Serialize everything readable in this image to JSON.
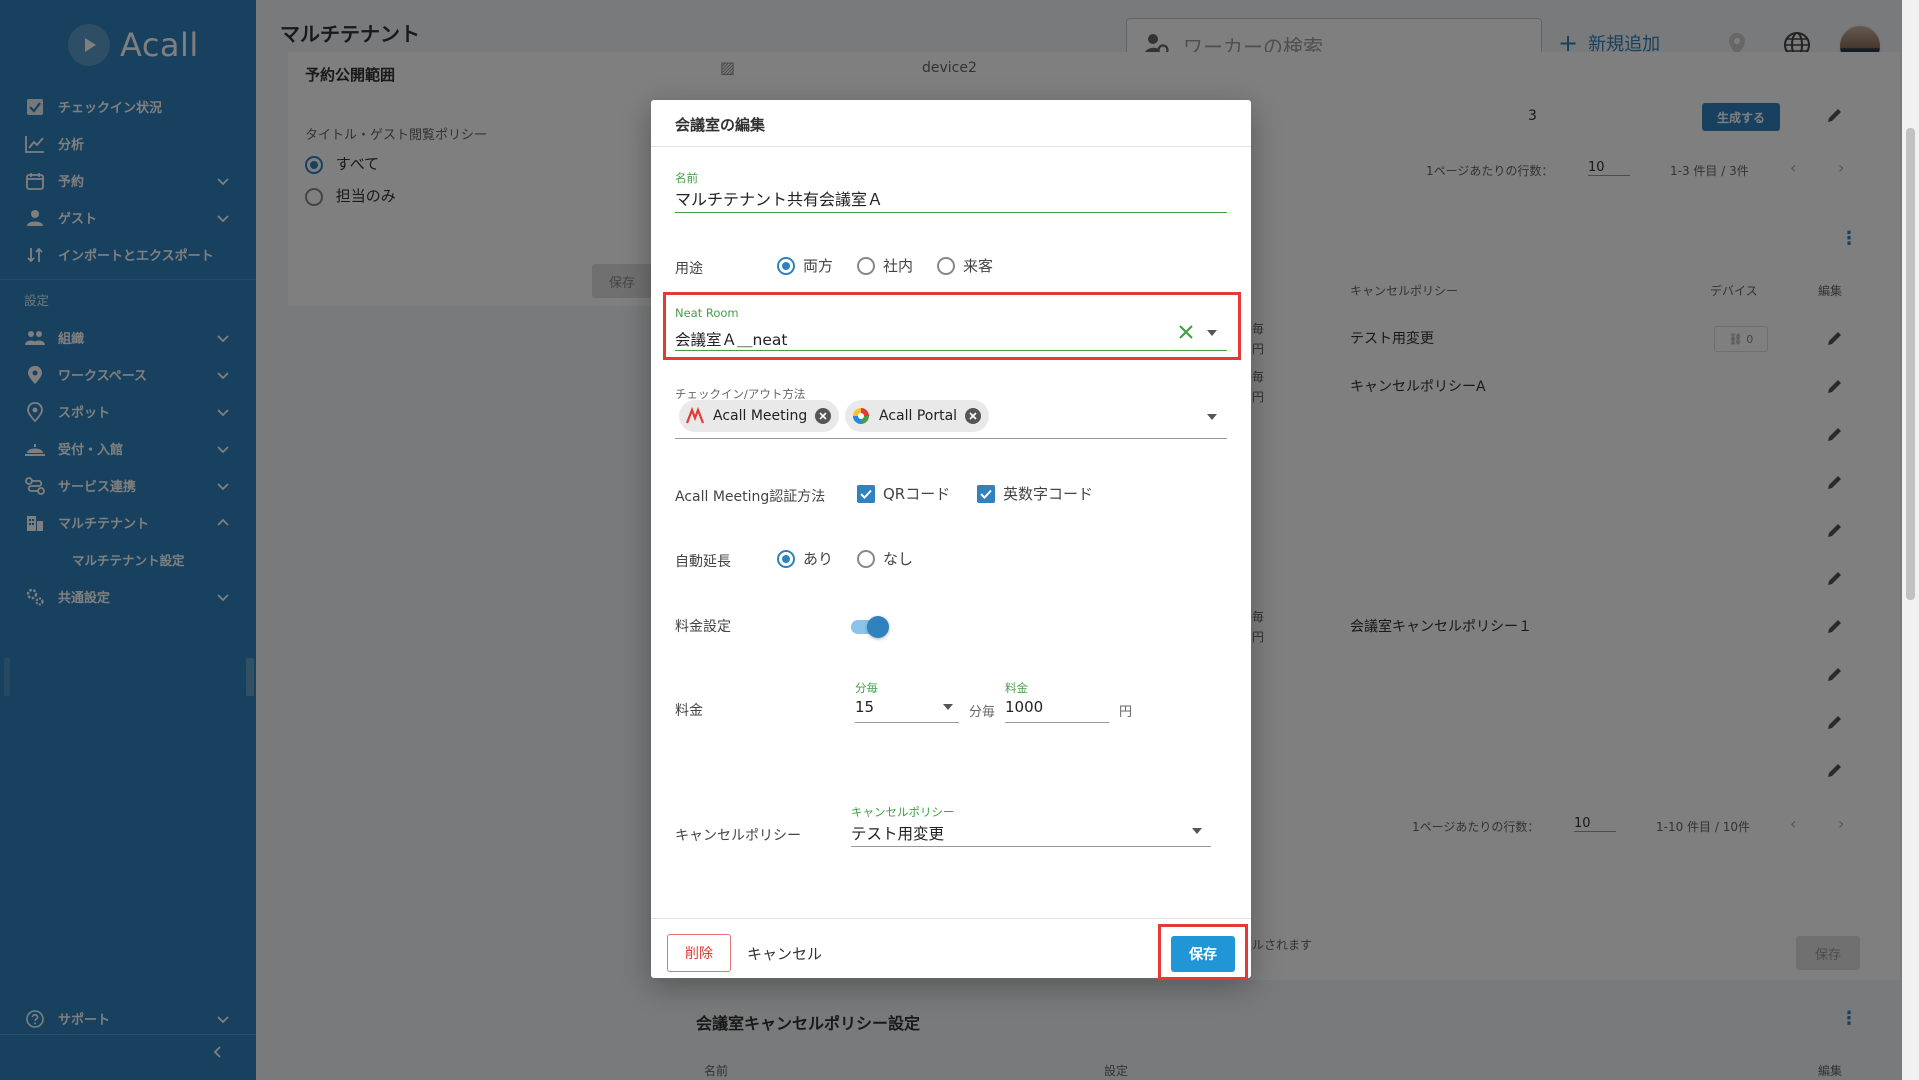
{
  "app": {
    "logo": "Acall",
    "page_title": "マルチテナント"
  },
  "sidebar": {
    "items": [
      {
        "label": "チェックイン状況",
        "icon": "check-box-icon"
      },
      {
        "label": "分析",
        "icon": "chart-icon"
      },
      {
        "label": "予約",
        "icon": "calendar-icon"
      },
      {
        "label": "ゲスト",
        "icon": "person-icon"
      },
      {
        "label": "インポートとエクスポート",
        "icon": "import-export-icon"
      }
    ],
    "section_label": "設定",
    "settings_items": [
      {
        "label": "組織",
        "icon": "group-icon"
      },
      {
        "label": "ワークスペース",
        "icon": "location-pin-icon"
      },
      {
        "label": "スポット",
        "icon": "spot-pin-icon"
      },
      {
        "label": "受付・入館",
        "icon": "reception-icon"
      },
      {
        "label": "サービス連携",
        "icon": "integration-icon"
      },
      {
        "label": "マルチテナント",
        "icon": "building-icon"
      }
    ],
    "sub_item": "マルチテナント設定",
    "common_settings": "共通設定",
    "support": "サポート"
  },
  "header": {
    "search_placeholder": "ワーカーの検索",
    "add_label": "新規追加"
  },
  "background": {
    "publish_scope_title": "予約公開範囲",
    "policy_label": "タイトル・ゲスト閲覧ポリシー",
    "policy_all": "すべて",
    "policy_owner": "担当のみ",
    "save": "保存",
    "device_col": "device2",
    "count": "3",
    "generate": "生成する",
    "rows_per_page": "1ページあたりの行数：",
    "rows_value": "10",
    "range1": "1-3 件目 / 3件",
    "range2": "1-10 件目 / 10件",
    "col_cancel_policy": "キャンセルポリシー",
    "col_device": "デバイス",
    "col_edit": "編集",
    "policy_rows": [
      "テスト用変更",
      "キャンセルポリシーA",
      "会議室キャンセルポリシー１"
    ],
    "device_badge": "0",
    "frag_1": "毎",
    "frag_2": "円",
    "notice_fragment": "ルされます",
    "cancel_policy_section": "会議室キャンセルポリシー設定",
    "col_name": "名前",
    "col_setting": "設定"
  },
  "modal": {
    "title": "会議室の編集",
    "name_label": "名前",
    "name_value": "マルチテナント共有会議室Ａ",
    "usage_label": "用途",
    "usage_options": [
      "両方",
      "社内",
      "来客"
    ],
    "usage_selected": "両方",
    "neat_label": "Neat Room",
    "neat_value": "会議室Ａ＿neat",
    "checkin_label": "チェックイン/アウト方法",
    "checkin_chips": [
      "Acall Meeting",
      "Acall Portal"
    ],
    "auth_label": "Acall Meeting認証方法",
    "auth_options": [
      "QRコード",
      "英数字コード"
    ],
    "auto_extend_label": "自動延長",
    "auto_extend_options": [
      "あり",
      "なし"
    ],
    "auto_extend_selected": "あり",
    "fee_setting_label": "料金設定",
    "fee_setting_on": true,
    "fee_label": "料金",
    "per_label": "分毎",
    "per_value": "15",
    "per_suffix": "分毎",
    "price_label": "料金",
    "price_value": "1000",
    "price_unit": "円",
    "cancel_policy_label": "キャンセルポリシー",
    "cancel_policy_field_label": "キャンセルポリシー",
    "cancel_policy_value": "テスト用変更",
    "delete": "削除",
    "cancel": "キャンセル",
    "save": "保存"
  },
  "colors": {
    "sidebar": "#2f82bd",
    "accent": "#2196d6",
    "green": "#43a047",
    "highlight": "#e53935"
  }
}
